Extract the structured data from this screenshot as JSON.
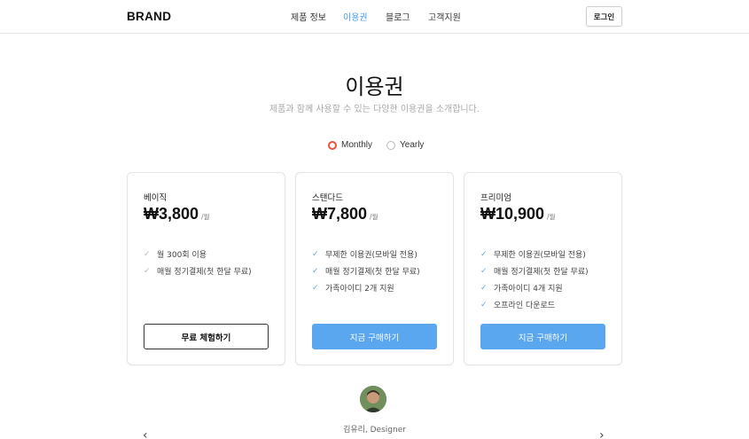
{
  "header": {
    "brand": "BRAND",
    "nav": [
      "제품 정보",
      "이용권",
      "블로그",
      "고객지원"
    ],
    "active_nav": "이용권",
    "login_label": "로그인"
  },
  "hero": {
    "title": "이용권",
    "subtitle": "제품과 함께 사용할 수 있는 다양한 이용권을 소개합니다."
  },
  "billing": {
    "options": [
      "Monthly",
      "Yearly"
    ],
    "selected": "Monthly"
  },
  "plans": [
    {
      "name": "베이직",
      "price": "₩3,800",
      "period": "/월",
      "features": [
        "월 300회 이용",
        "매월 정기결제(첫 한달 무료)"
      ],
      "cta": "무료 체험하기"
    },
    {
      "name": "스탠다드",
      "price": "₩7,800",
      "period": "/월",
      "features": [
        "무제한 이용권(모바일 전용)",
        "매월 정기결제(첫 한달 무료)",
        "가족아이디 2개 지원"
      ],
      "cta": "지금 구매하기"
    },
    {
      "name": "프리미엄",
      "price": "₩10,900",
      "period": "/월",
      "features": [
        "무제한 이용권(모바일 전용)",
        "매월 정기결제(첫 한달 무료)",
        "가족아이디 4개 지원",
        "오프라인 다운로드"
      ],
      "cta": "지금 구매하기"
    }
  ],
  "testimonial": {
    "reviewer": "김유리, Designer"
  },
  "colors": {
    "accent": "#5aa7f0",
    "nav_active": "#4b9cf5",
    "radio_selected": "#e8503f"
  },
  "icons": {
    "check": "check-icon",
    "prev": "chevron-left-icon",
    "next": "chevron-right-icon"
  }
}
